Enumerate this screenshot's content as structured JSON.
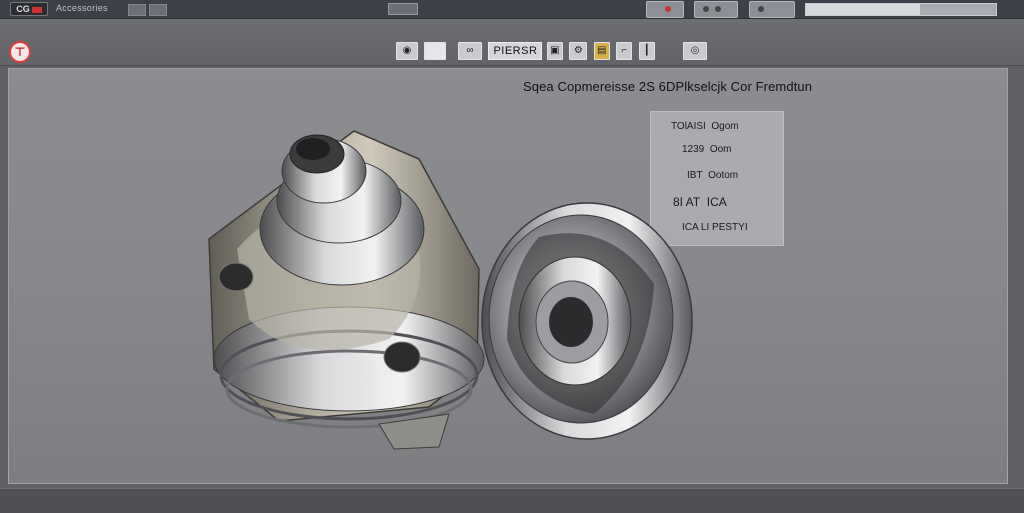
{
  "titlebar": {
    "title": "Accessories",
    "progress_fraction": 0.6
  },
  "toolbar": {
    "label": "PIERSR"
  },
  "viewport": {
    "title": "Sqea Copmereisse 2S 6DPlkselcjk Cor Fremdtun"
  },
  "info_panel": {
    "rows": [
      {
        "code": "TOlAISI",
        "value": "Ogom"
      },
      {
        "code": "1239",
        "value": "Oom"
      },
      {
        "code": "IBT",
        "value": "Ootom"
      },
      {
        "code": "8I AT",
        "value": "ICA"
      },
      {
        "code": "ICA LI",
        "value": "PESTYI"
      }
    ]
  },
  "colors": {
    "accent_red": "#e13b3b",
    "background": "#86888b",
    "metal_light": "#d8d9db",
    "metal_dark": "#3a3b3d"
  }
}
